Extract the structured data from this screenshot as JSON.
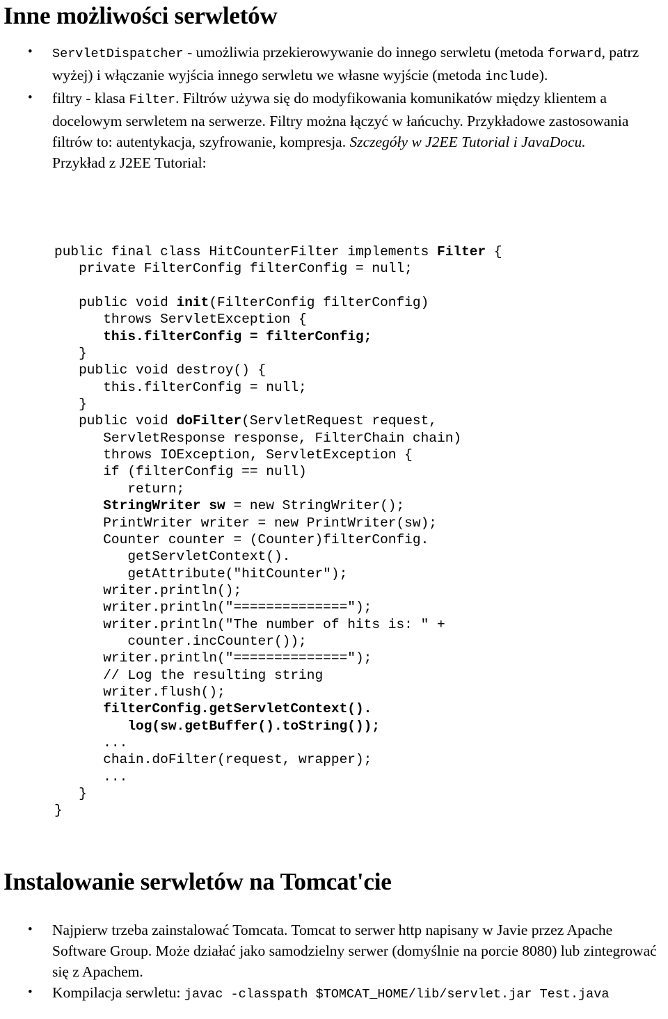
{
  "document": {
    "language": "pl",
    "heading_1": "Inne możliwości serwletów",
    "heading_2": "Instalowanie serwletów na Tomcat'cie"
  },
  "bullets_top": [
    {
      "id": "servlet-dispatcher",
      "segments": [
        {
          "style": "mono",
          "text": "ServletDispatcher"
        },
        {
          "style": "normal",
          "text": " - umożliwia przekierowywanie do innego serwletu (metoda "
        },
        {
          "style": "mono",
          "text": "forward"
        },
        {
          "style": "normal",
          "text": ", patrz wyżej) i włączanie wyjścia innego serwletu we własne wyjście (metoda "
        },
        {
          "style": "mono",
          "text": "include"
        },
        {
          "style": "normal",
          "text": ")."
        }
      ]
    },
    {
      "id": "filters",
      "segments": [
        {
          "style": "normal",
          "text": "filtry - klasa "
        },
        {
          "style": "mono",
          "text": "Filter"
        },
        {
          "style": "normal",
          "text": ". Filtrów używa się do modyfikowania komunikatów między klientem a docelowym serwletem na serwerze. Filtry można łączyć w łańcuchy. Przykładowe zastosowania filtrów to: autentykacja, szyfrowanie, kompresja. "
        },
        {
          "style": "italic",
          "text": "Szczegóły w J2EE Tutorial i JavaDocu."
        },
        {
          "style": "break",
          "text": ""
        },
        {
          "style": "normal",
          "text": "Przykład z J2EE Tutorial:"
        }
      ]
    }
  ],
  "code_block": {
    "language": "java",
    "lines": [
      [
        {
          "b": false,
          "t": "public final class HitCounterFilter implements "
        },
        {
          "b": true,
          "t": "Filter"
        },
        {
          "b": false,
          "t": " {"
        }
      ],
      [
        {
          "b": false,
          "t": "   private FilterConfig filterConfig = null;"
        }
      ],
      [
        {
          "b": false,
          "t": ""
        }
      ],
      [
        {
          "b": false,
          "t": "   public void "
        },
        {
          "b": true,
          "t": "init"
        },
        {
          "b": false,
          "t": "(FilterConfig filterConfig)"
        }
      ],
      [
        {
          "b": false,
          "t": "      throws ServletException {"
        }
      ],
      [
        {
          "b": true,
          "t": "      this.filterConfig = filterConfig;"
        }
      ],
      [
        {
          "b": false,
          "t": "   }"
        }
      ],
      [
        {
          "b": false,
          "t": "   public void destroy() {"
        }
      ],
      [
        {
          "b": false,
          "t": "      this.filterConfig = null;"
        }
      ],
      [
        {
          "b": false,
          "t": "   }"
        }
      ],
      [
        {
          "b": false,
          "t": "   public void "
        },
        {
          "b": true,
          "t": "doFilter"
        },
        {
          "b": false,
          "t": "(ServletRequest request,"
        }
      ],
      [
        {
          "b": false,
          "t": "      ServletResponse response, FilterChain chain)"
        }
      ],
      [
        {
          "b": false,
          "t": "      throws IOException, ServletException {"
        }
      ],
      [
        {
          "b": false,
          "t": "      if (filterConfig == null)"
        }
      ],
      [
        {
          "b": false,
          "t": "         return;"
        }
      ],
      [
        {
          "b": true,
          "t": "      StringWriter sw"
        },
        {
          "b": false,
          "t": " = new StringWriter();"
        }
      ],
      [
        {
          "b": false,
          "t": "      PrintWriter writer = new PrintWriter(sw);"
        }
      ],
      [
        {
          "b": false,
          "t": "      Counter counter = (Counter)filterConfig."
        }
      ],
      [
        {
          "b": false,
          "t": "         getServletContext()."
        }
      ],
      [
        {
          "b": false,
          "t": "         getAttribute(\"hitCounter\");"
        }
      ],
      [
        {
          "b": false,
          "t": "      writer.println();"
        }
      ],
      [
        {
          "b": false,
          "t": "      writer.println(\"==============\");"
        }
      ],
      [
        {
          "b": false,
          "t": "      writer.println(\"The number of hits is: \" +"
        }
      ],
      [
        {
          "b": false,
          "t": "         counter.incCounter());"
        }
      ],
      [
        {
          "b": false,
          "t": "      writer.println(\"==============\");"
        }
      ],
      [
        {
          "b": false,
          "t": "      // Log the resulting string"
        }
      ],
      [
        {
          "b": false,
          "t": "      writer.flush();"
        }
      ],
      [
        {
          "b": true,
          "t": "      filterConfig.getServletContext()."
        }
      ],
      [
        {
          "b": true,
          "t": "         log(sw.getBuffer().toString());"
        }
      ],
      [
        {
          "b": false,
          "t": "      ..."
        }
      ],
      [
        {
          "b": false,
          "t": "      chain.doFilter(request, wrapper);"
        }
      ],
      [
        {
          "b": false,
          "t": "      ..."
        }
      ],
      [
        {
          "b": false,
          "t": "   }"
        }
      ],
      [
        {
          "b": false,
          "t": "}"
        }
      ]
    ]
  },
  "bullets_bottom": [
    {
      "id": "install-tomcat",
      "segments": [
        {
          "style": "normal",
          "text": "Najpierw trzeba zainstalować Tomcata. Tomcat to serwer http napisany w Javie przez Apache Software Group. Może działać jako samodzielny serwer (domyślnie na porcie 8080) lub zintegrować się z Apachem."
        }
      ]
    },
    {
      "id": "compile-servlet",
      "segments": [
        {
          "style": "normal",
          "text": "Kompilacja serwletu: "
        },
        {
          "style": "mono",
          "text": "javac -classpath $TOMCAT_HOME/lib/servlet.jar Test.java"
        }
      ]
    }
  ],
  "icons": {
    "bullet": "•"
  }
}
